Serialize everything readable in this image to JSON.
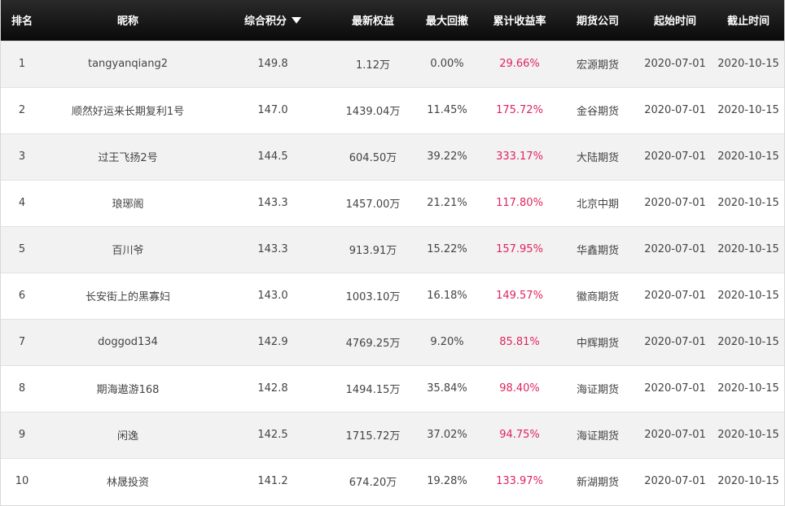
{
  "table": {
    "headers": {
      "rank": "排名",
      "nickname": "昵称",
      "score": "综合积分",
      "equity": "最新权益",
      "drawdown": "最大回撤",
      "return": "累计收益率",
      "company": "期货公司",
      "start": "起始时间",
      "end": "截止时间"
    },
    "sort": {
      "column": "score",
      "direction": "descending",
      "icon": "triangle-down-icon"
    },
    "colors": {
      "header_bg": "#111111",
      "return_text": "#e0245e",
      "row_alt": "#f2f2f2"
    },
    "rows": [
      {
        "rank": "1",
        "nickname": "tangyanqiang2",
        "score": "149.8",
        "equity": "1.12万",
        "drawdown": "0.00%",
        "return": "29.66%",
        "company": "宏源期货",
        "start": "2020-07-01",
        "end": "2020-10-15"
      },
      {
        "rank": "2",
        "nickname": "顺然好运来长期复利1号",
        "score": "147.0",
        "equity": "1439.04万",
        "drawdown": "11.45%",
        "return": "175.72%",
        "company": "金谷期货",
        "start": "2020-07-01",
        "end": "2020-10-15"
      },
      {
        "rank": "3",
        "nickname": "过王飞扬2号",
        "score": "144.5",
        "equity": "604.50万",
        "drawdown": "39.22%",
        "return": "333.17%",
        "company": "大陆期货",
        "start": "2020-07-01",
        "end": "2020-10-15"
      },
      {
        "rank": "4",
        "nickname": "琅琊阁",
        "score": "143.3",
        "equity": "1457.00万",
        "drawdown": "21.21%",
        "return": "117.80%",
        "company": "北京中期",
        "start": "2020-07-01",
        "end": "2020-10-15"
      },
      {
        "rank": "5",
        "nickname": "百川爷",
        "score": "143.3",
        "equity": "913.91万",
        "drawdown": "15.22%",
        "return": "157.95%",
        "company": "华鑫期货",
        "start": "2020-07-01",
        "end": "2020-10-15"
      },
      {
        "rank": "6",
        "nickname": "长安街上的黑寡妇",
        "score": "143.0",
        "equity": "1003.10万",
        "drawdown": "16.18%",
        "return": "149.57%",
        "company": "徽商期货",
        "start": "2020-07-01",
        "end": "2020-10-15"
      },
      {
        "rank": "7",
        "nickname": "doggod134",
        "score": "142.9",
        "equity": "4769.25万",
        "drawdown": "9.20%",
        "return": "85.81%",
        "company": "中辉期货",
        "start": "2020-07-01",
        "end": "2020-10-15"
      },
      {
        "rank": "8",
        "nickname": "期海遨游168",
        "score": "142.8",
        "equity": "1494.15万",
        "drawdown": "35.84%",
        "return": "98.40%",
        "company": "海证期货",
        "start": "2020-07-01",
        "end": "2020-10-15"
      },
      {
        "rank": "9",
        "nickname": "闲逸",
        "score": "142.5",
        "equity": "1715.72万",
        "drawdown": "37.02%",
        "return": "94.75%",
        "company": "海证期货",
        "start": "2020-07-01",
        "end": "2020-10-15"
      },
      {
        "rank": "10",
        "nickname": "林晟投资",
        "score": "141.2",
        "equity": "674.20万",
        "drawdown": "19.28%",
        "return": "133.97%",
        "company": "新湖期货",
        "start": "2020-07-01",
        "end": "2020-10-15"
      }
    ]
  }
}
